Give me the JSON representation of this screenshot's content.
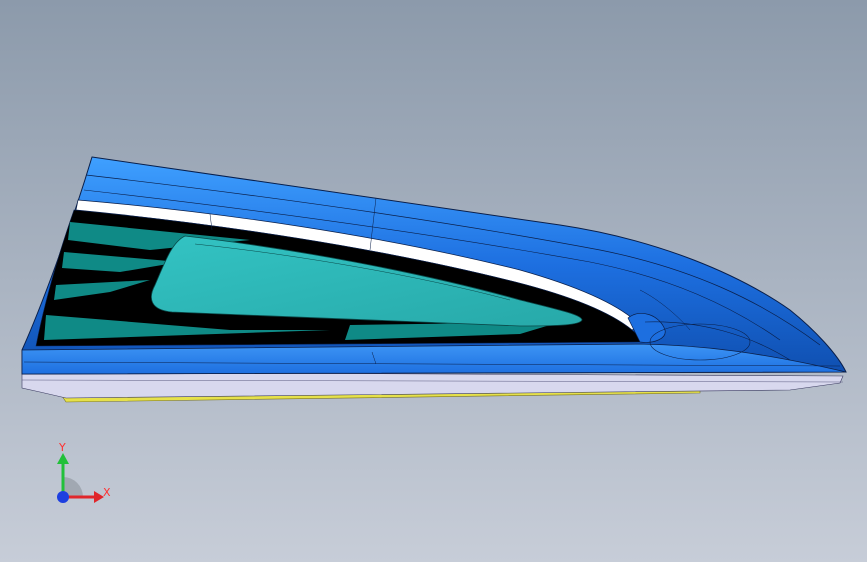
{
  "viewport": {
    "background_top": "#8c9aab",
    "background_bottom": "#c7cdd8"
  },
  "model": {
    "colors": {
      "shell_blue": "#1d6fe0",
      "shell_blue_light": "#3fa0ff",
      "shell_blue_dark": "#0f4fb0",
      "inner_teal": "#0f8a86",
      "inner_teal_light": "#33c3c3",
      "cavity_black": "#000000",
      "trim_white": "#ffffff",
      "base_lavender": "#d8d8ee",
      "base_yellow": "#e6e14a",
      "edge_line": "#0a1f4a"
    }
  },
  "triad": {
    "y_label": "Y",
    "x_label": "X",
    "colors": {
      "y_axis": "#22c03a",
      "x_axis": "#e0262b",
      "z_axis": "#1d3fe0",
      "label": "#ff3030"
    }
  }
}
